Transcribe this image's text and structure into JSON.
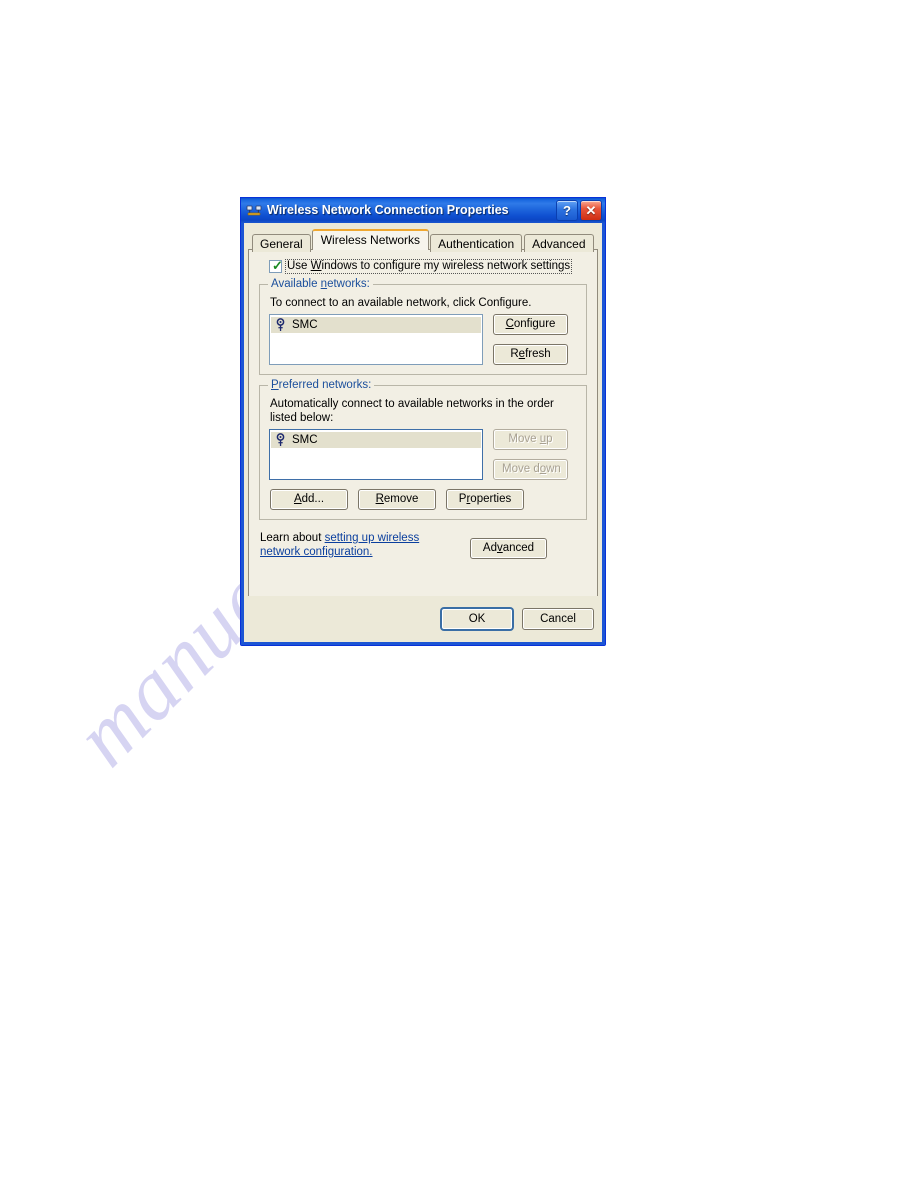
{
  "page": {
    "watermark": "manualshive.com",
    "background_color": "#ffffff"
  },
  "dialog": {
    "title": "Wireless Network Connection Properties",
    "icon": "network-connection-icon",
    "titlebar_color": "#1a68e0",
    "window_background": "#ece9d8",
    "titlebar_buttons": {
      "help": "?",
      "close": "✕"
    },
    "tabs": [
      {
        "label": "General",
        "active": false
      },
      {
        "label": "Wireless Networks",
        "active": true
      },
      {
        "label": "Authentication",
        "active": false
      },
      {
        "label": "Advanced",
        "active": false
      }
    ],
    "active_tab_accent": "#f0a830",
    "use_windows": {
      "label_prefix": "Use ",
      "label_accel": "W",
      "label_suffix": "indows to configure my wireless network settings",
      "checked": true,
      "check_color": "#1a8a22"
    },
    "available_networks": {
      "title_prefix": "Available ",
      "title_accel": "n",
      "title_suffix": "etworks:",
      "description": "To connect to an available network, click Configure.",
      "items": [
        {
          "name": "SMC",
          "icon": "wireless-network-icon",
          "selected": true
        }
      ],
      "buttons": [
        {
          "prefix": "",
          "accel": "C",
          "suffix": "onfigure",
          "name": "configure",
          "disabled": false
        },
        {
          "prefix": "R",
          "accel": "e",
          "suffix": "fresh",
          "name": "refresh",
          "disabled": false
        }
      ]
    },
    "preferred_networks": {
      "title_prefix": "",
      "title_accel": "P",
      "title_suffix": "referred networks:",
      "description": "Automatically connect to available networks in the order listed below:",
      "items": [
        {
          "name": "SMC",
          "icon": "wireless-network-icon",
          "selected": true
        }
      ],
      "move_buttons": [
        {
          "prefix": "Move ",
          "accel": "u",
          "suffix": "p",
          "name": "move-up",
          "disabled": true
        },
        {
          "prefix": "Move d",
          "accel": "o",
          "suffix": "wn",
          "name": "move-down",
          "disabled": true
        }
      ],
      "action_buttons": [
        {
          "prefix": "",
          "accel": "A",
          "suffix": "dd...",
          "name": "add",
          "disabled": false
        },
        {
          "prefix": "",
          "accel": "R",
          "suffix": "emove",
          "name": "remove",
          "disabled": false
        },
        {
          "prefix": "P",
          "accel": "r",
          "suffix": "operties",
          "name": "properties",
          "disabled": false
        }
      ]
    },
    "learn": {
      "lead": "Learn about ",
      "link": "setting up wireless network configuration.",
      "link_color": "#0b3f9e"
    },
    "advanced_button": {
      "prefix": "Ad",
      "accel": "v",
      "suffix": "anced",
      "disabled": false
    },
    "footer_buttons": [
      {
        "label": "OK",
        "name": "ok",
        "default": true
      },
      {
        "label": "Cancel",
        "name": "cancel",
        "default": false
      }
    ]
  }
}
